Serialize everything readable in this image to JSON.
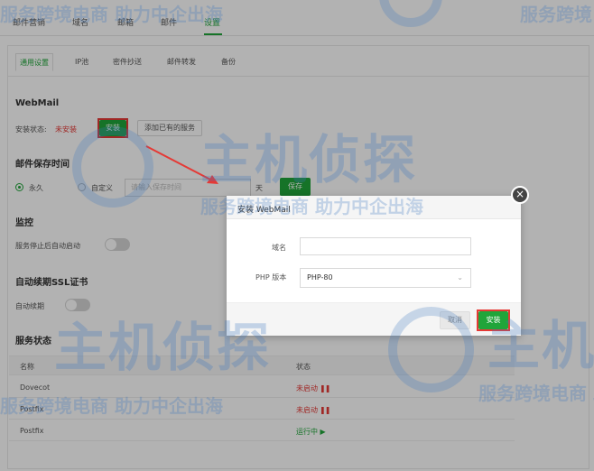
{
  "topnav": {
    "tabs": [
      "邮件营销",
      "域名",
      "邮箱",
      "邮件",
      "设置"
    ],
    "active_index": 4
  },
  "subtabs": [
    "通用设置",
    "IP池",
    "密件抄送",
    "邮件转发",
    "备份"
  ],
  "webmail": {
    "title": "WebMail",
    "status_label": "安装状态:",
    "status_value": "未安装",
    "install_button": "安装",
    "add_existing_button": "添加已有的服务"
  },
  "mail_retention": {
    "title": "邮件保存时间",
    "option_forever": "永久",
    "option_custom": "自定义",
    "custom_placeholder": "请输入保存时间",
    "unit": "天",
    "save_button": "保存"
  },
  "monitor": {
    "title": "监控",
    "auto_restart_label": "服务停止后自动启动"
  },
  "ssl": {
    "title": "自动续期SSL证书",
    "auto_renew_label": "自动续期"
  },
  "service_status": {
    "title": "服务状态",
    "columns": [
      "名称",
      "状态"
    ],
    "rows": [
      {
        "name": "Dovecot",
        "status": "未启动",
        "state": "stopped"
      },
      {
        "name": "Postfix",
        "status": "未启动",
        "state": "stopped"
      },
      {
        "name": "Postfix",
        "status": "运行中",
        "state": "running"
      }
    ]
  },
  "dialog": {
    "title": "安装 WebMail",
    "domain_label": "域名",
    "domain_value": "",
    "php_label": "PHP 版本",
    "php_value": "PHP-80",
    "cancel_button": "取消",
    "install_button": "安装"
  },
  "watermark": {
    "brand_main": "主机侦探",
    "slogan": "服务跨境电商 助力中企出海"
  },
  "colors": {
    "accent": "#20a53a",
    "danger": "#e53935",
    "watermark": "#3c78be"
  }
}
